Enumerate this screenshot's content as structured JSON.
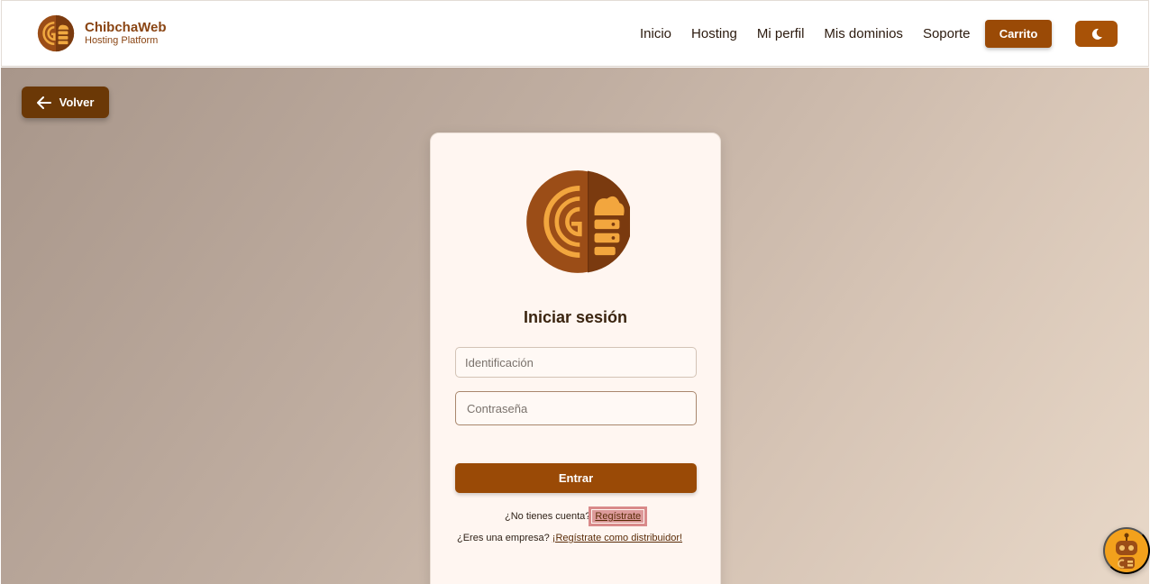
{
  "brand": {
    "name": "ChibchaWeb",
    "subtitle": "Hosting Platform"
  },
  "nav": {
    "items": [
      "Inicio",
      "Hosting",
      "Mi perfil",
      "Mis dominios",
      "Soporte"
    ],
    "cart_label": "Carrito",
    "theme_icon": "moon-icon"
  },
  "back": {
    "label": "Volver",
    "icon": "arrow-left-icon"
  },
  "login": {
    "title": "Iniciar sesión",
    "id_placeholder": "Identificación",
    "id_value": "",
    "password_placeholder": "Contraseña",
    "password_value": "",
    "submit_label": "Entrar",
    "no_account_text": "¿No tienes cuenta?",
    "register_link": "Regístrate",
    "company_text": "¿Eres una empresa?",
    "distributor_link": "¡Regístrate como distribuidor!"
  },
  "colors": {
    "accent": "#9a4a06",
    "brand_text": "#8a4513",
    "back_button": "#6b3806",
    "card_bg": "#fff6f1",
    "chatbot_bg": "#f3a11c"
  },
  "assistant": {
    "icon": "robot-assistant-icon"
  }
}
